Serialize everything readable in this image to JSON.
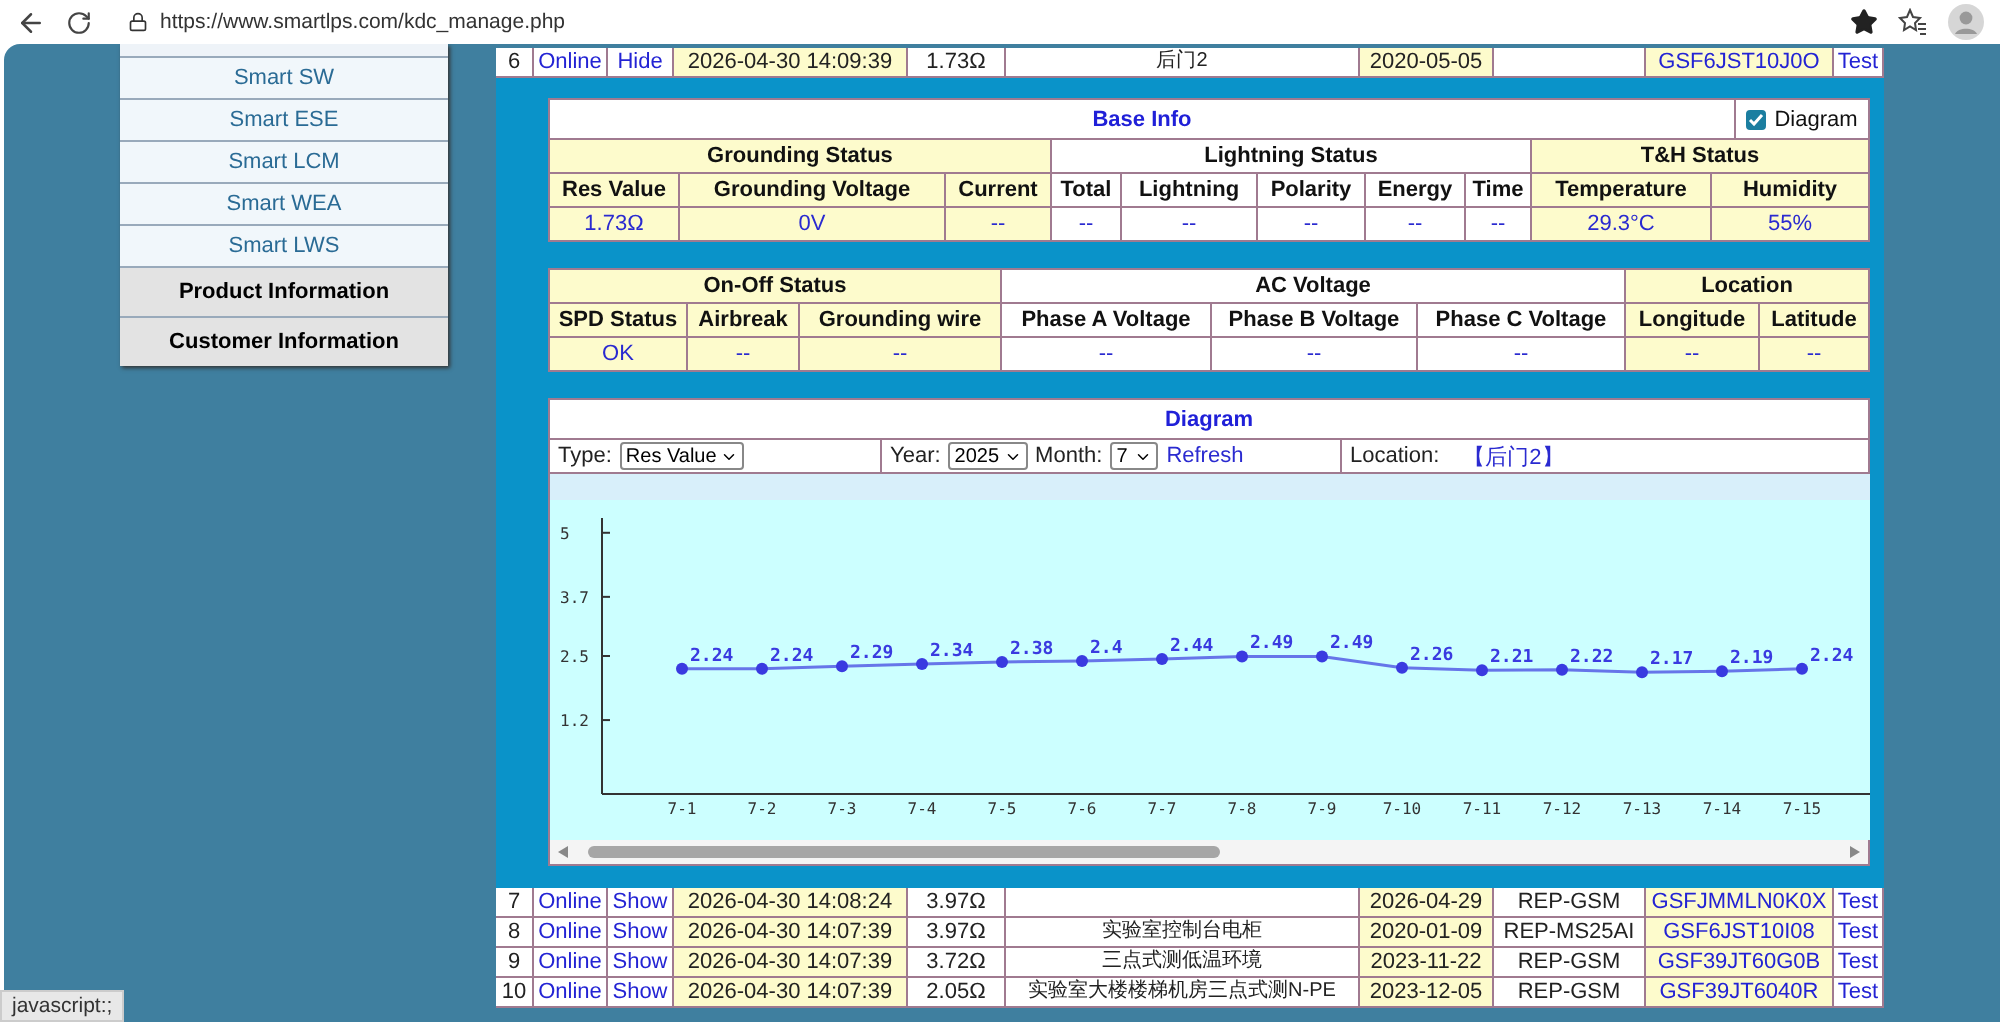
{
  "browser": {
    "url": "https://www.smartlps.com/kdc_manage.php"
  },
  "sidebar": {
    "items": [
      {
        "label": "Smart SW",
        "kind": "sub"
      },
      {
        "label": "Smart ESE",
        "kind": "sub"
      },
      {
        "label": "Smart LCM",
        "kind": "sub"
      },
      {
        "label": "Smart WEA",
        "kind": "sub"
      },
      {
        "label": "Smart LWS",
        "kind": "sub"
      },
      {
        "label": "Product Information",
        "kind": "section"
      },
      {
        "label": "Customer Information",
        "kind": "section"
      }
    ]
  },
  "records": [
    {
      "number": "6",
      "status": "Online",
      "toggle": "Hide",
      "time": "2026-04-30 14:09:39",
      "resistance": "1.73Ω",
      "location": "后门2",
      "date": "2020-05-05",
      "serial": "GSF6JST10J0O",
      "action": "Test",
      "expanded": true
    },
    {
      "number": "7",
      "status": "Online",
      "toggle": "Show",
      "time": "2026-04-30 14:08:24",
      "resistance": "3.97Ω",
      "date": "2026-04-29",
      "model": "REP-GSM",
      "serial": "GSFJMMLN0K0X",
      "action": "Test",
      "expanded": false
    },
    {
      "number": "8",
      "status": "Online",
      "toggle": "Show",
      "time": "2026-04-30 14:07:39",
      "resistance": "3.97Ω",
      "location": "实验室控制台电柜",
      "date": "2020-01-09",
      "model": "REP-MS25AI",
      "serial": "GSF6JST10I08",
      "action": "Test",
      "expanded": false
    },
    {
      "number": "9",
      "status": "Online",
      "toggle": "Show",
      "time": "2026-04-30 14:07:39",
      "resistance": "3.72Ω",
      "location": "三点式测低温环境",
      "date": "2023-11-22",
      "model": "REP-GSM",
      "serial": "GSF39JT60G0B",
      "action": "Test",
      "expanded": false
    },
    {
      "number": "10",
      "status": "Online",
      "toggle": "Show",
      "time": "2026-04-30 14:07:39",
      "resistance": "2.05Ω",
      "location": "实验室大楼楼梯机房三点式测N-PE",
      "date": "2023-12-05",
      "model": "REP-GSM",
      "serial": "GSF39JT6040R",
      "action": "Test",
      "expanded": false
    }
  ],
  "detail": {
    "base_info": {
      "title": "Base Info",
      "diagram_toggle": {
        "label": "Diagram",
        "checked": true
      },
      "groups": [
        {
          "label": "Grounding Status",
          "highlighted": true,
          "columns": [
            {
              "label": "Res Value",
              "value": "1.73Ω"
            },
            {
              "label": "Grounding Voltage",
              "value": "0V"
            },
            {
              "label": "Current",
              "value": "--"
            }
          ]
        },
        {
          "label": "Lightning Status",
          "highlighted": false,
          "columns": [
            {
              "label": "Total",
              "value": "--"
            },
            {
              "label": "Lightning",
              "value": "--"
            },
            {
              "label": "Polarity",
              "value": "--"
            },
            {
              "label": "Energy",
              "value": "--"
            },
            {
              "label": "Time",
              "value": "--"
            }
          ]
        },
        {
          "label": "T&H Status",
          "highlighted": true,
          "columns": [
            {
              "label": "Temperature",
              "value": "29.3°C"
            },
            {
              "label": "Humidity",
              "value": "55%"
            }
          ]
        }
      ]
    },
    "status_info": {
      "groups": [
        {
          "label": "On-Off Status",
          "highlighted": true,
          "columns": [
            {
              "label": "SPD Status",
              "value": "OK"
            },
            {
              "label": "Airbreak",
              "value": "--"
            },
            {
              "label": "Grounding wire",
              "value": "--"
            }
          ]
        },
        {
          "label": "AC Voltage",
          "highlighted": false,
          "columns": [
            {
              "label": "Phase A Voltage",
              "value": "--"
            },
            {
              "label": "Phase B Voltage",
              "value": "--"
            },
            {
              "label": "Phase C Voltage",
              "value": "--"
            }
          ]
        },
        {
          "label": "Location",
          "highlighted": true,
          "columns": [
            {
              "label": "Longitude",
              "value": "--"
            },
            {
              "label": "Latitude",
              "value": "--"
            }
          ]
        }
      ]
    },
    "diagram": {
      "title": "Diagram",
      "type_label": "Type:",
      "type_value": "Res Value",
      "year_label": "Year:",
      "year_value": "2025",
      "month_label": "Month:",
      "month_value": "7",
      "refresh": "Refresh",
      "location_label": "Location:",
      "location_value": "【后门2】",
      "chart_data": {
        "type": "line",
        "categories": [
          "7-1",
          "7-2",
          "7-3",
          "7-4",
          "7-5",
          "7-6",
          "7-7",
          "7-8",
          "7-9",
          "7-10",
          "7-11",
          "7-12",
          "7-13",
          "7-14",
          "7-15"
        ],
        "series": [
          {
            "color": "#3a3ae0",
            "marker": "circle",
            "values": [
              2.24,
              2.24,
              2.29,
              2.34,
              2.38,
              2.4,
              2.44,
              2.49,
              2.49,
              2.26,
              2.21,
              2.22,
              2.17,
              2.19,
              2.24
            ]
          }
        ],
        "ylim": [
          -0.3,
          5.3
        ],
        "yticks": [
          1.2,
          2.5,
          3.7,
          5
        ],
        "data_labels": true
      }
    }
  },
  "status_text": "javascript:;"
}
